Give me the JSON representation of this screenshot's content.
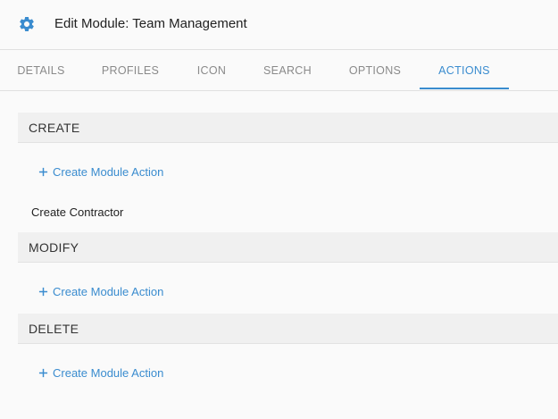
{
  "header": {
    "icon": "gear-icon",
    "title": "Edit Module: Team Management"
  },
  "tabs": [
    {
      "label": "DETAILS",
      "active": false
    },
    {
      "label": "PROFILES",
      "active": false
    },
    {
      "label": "ICON",
      "active": false
    },
    {
      "label": "SEARCH",
      "active": false
    },
    {
      "label": "OPTIONS",
      "active": false
    },
    {
      "label": "ACTIONS",
      "active": true
    }
  ],
  "sections": [
    {
      "title": "CREATE",
      "add_label": "Create Module Action",
      "items": [
        "Create Contractor"
      ]
    },
    {
      "title": "MODIFY",
      "add_label": "Create Module Action",
      "items": []
    },
    {
      "title": "DELETE",
      "add_label": "Create Module Action",
      "items": []
    }
  ],
  "colors": {
    "accent": "#3a8ccf",
    "tab_inactive": "#8a8a8a",
    "section_bg": "#f0f0f0"
  }
}
